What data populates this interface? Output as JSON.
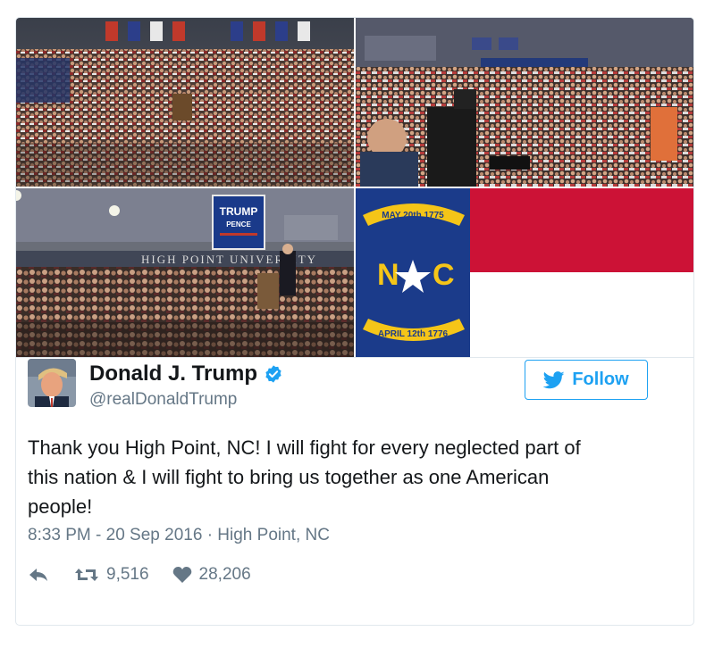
{
  "tweet": {
    "author_name": "Donald J. Trump",
    "author_handle": "@realDonaldTrump",
    "follow_label": "Follow",
    "text_lines": [
      "Thank you High Point, NC! I will fight for every neglected part of",
      "this nation & I will fight to bring us together as one American",
      "people!"
    ],
    "meta": "8:33 PM - 20 Sep 2016 · High Point, NC",
    "retweets": "9,516",
    "likes": "28,206"
  },
  "media": {
    "sign_line1": "TRUMP",
    "sign_line2": "PENCE",
    "wall_text": "HIGH POINT UNIVERSITY",
    "flag_top": "MAY 20th 1775",
    "flag_bottom": "APRIL 12th 1776",
    "flag_left_letter": "N",
    "flag_right_letter": "C"
  },
  "colors": {
    "accent": "#1da1f2",
    "text": "#14171a",
    "secondary": "#657786",
    "border": "#e1e8ed",
    "flag_blue": "#1b3b8a",
    "flag_red": "#cc1236",
    "flag_gold": "#f5c518"
  },
  "icons": [
    "verified-badge-icon",
    "twitter-bird-icon",
    "reply-icon",
    "retweet-icon",
    "heart-icon"
  ]
}
